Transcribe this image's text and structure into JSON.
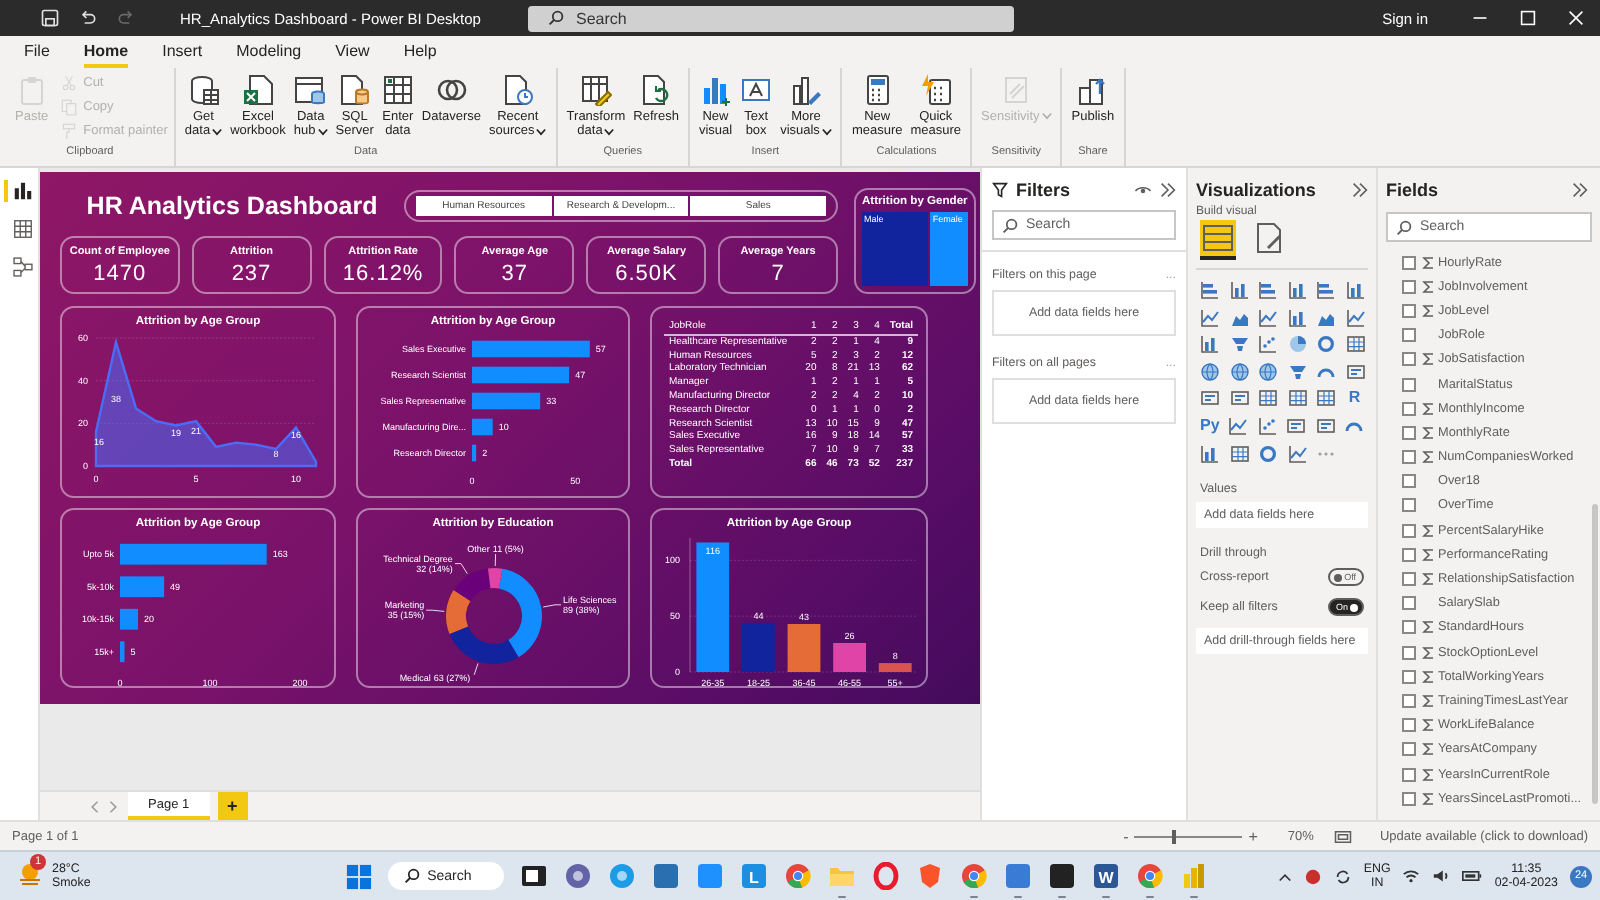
{
  "window": {
    "title": "HR_Analytics Dashboard - Power BI Desktop",
    "search": "Search",
    "sign_in": "Sign in"
  },
  "quick_access": [
    {
      "kind": "save",
      "disabled": false
    },
    {
      "kind": "undo",
      "disabled": false
    },
    {
      "kind": "redo",
      "disabled": true
    }
  ],
  "menu_tabs": [
    {
      "label": "File",
      "selected": false
    },
    {
      "label": "Home",
      "selected": true
    },
    {
      "label": "Insert",
      "selected": false
    },
    {
      "label": "Modeling",
      "selected": false
    },
    {
      "label": "View",
      "selected": false
    },
    {
      "label": "Help",
      "selected": false
    }
  ],
  "ribbon": [
    {
      "group": "Clipboard",
      "buttons": [
        {
          "kind": "paste",
          "label": "Paste",
          "disabled": true,
          "dropdown": false
        }
      ],
      "small_buttons": [
        {
          "kind": "cut",
          "label": "Cut",
          "disabled": true
        },
        {
          "kind": "copy",
          "label": "Copy",
          "disabled": true
        },
        {
          "kind": "painter",
          "label": "Format painter",
          "disabled": true
        }
      ]
    },
    {
      "group": "Data",
      "buttons": [
        {
          "kind": "database",
          "label": "Get\ndata",
          "disabled": false,
          "dropdown": true
        },
        {
          "kind": "excel",
          "label": "Excel\nworkbook",
          "disabled": false,
          "dropdown": false
        },
        {
          "kind": "datahub",
          "label": "Data\nhub",
          "disabled": false,
          "dropdown": true
        },
        {
          "kind": "sql",
          "label": "SQL\nServer",
          "disabled": false,
          "dropdown": false
        },
        {
          "kind": "enter",
          "label": "Enter\ndata",
          "disabled": false,
          "dropdown": false
        },
        {
          "kind": "dataverse",
          "label": "Dataverse",
          "disabled": false,
          "dropdown": false
        },
        {
          "kind": "recent",
          "label": "Recent\nsources",
          "disabled": false,
          "dropdown": true
        }
      ]
    },
    {
      "group": "Queries",
      "buttons": [
        {
          "kind": "transform",
          "label": "Transform\ndata",
          "disabled": false,
          "dropdown": true
        },
        {
          "kind": "refresh",
          "label": "Refresh",
          "disabled": false,
          "dropdown": false
        }
      ]
    },
    {
      "group": "Insert",
      "buttons": [
        {
          "kind": "newvisual",
          "label": "New\nvisual",
          "disabled": false,
          "dropdown": false
        },
        {
          "kind": "textbox",
          "label": "Text\nbox",
          "disabled": false,
          "dropdown": false
        },
        {
          "kind": "morevisuals",
          "label": "More\nvisuals",
          "disabled": false,
          "dropdown": true
        }
      ]
    },
    {
      "group": "Calculations",
      "buttons": [
        {
          "kind": "measure",
          "label": "New\nmeasure",
          "disabled": false,
          "dropdown": false
        },
        {
          "kind": "quickmeasure",
          "label": "Quick\nmeasure",
          "disabled": false,
          "dropdown": false
        }
      ]
    },
    {
      "group": "Sensitivity",
      "buttons": [
        {
          "kind": "sensitivity",
          "label": "Sensitivity",
          "disabled": true,
          "dropdown": true
        }
      ]
    },
    {
      "group": "Share",
      "buttons": [
        {
          "kind": "publish",
          "label": "Publish",
          "disabled": false,
          "dropdown": false
        }
      ]
    }
  ],
  "views": [
    {
      "kind": "report",
      "selected": true
    },
    {
      "kind": "table",
      "selected": false
    },
    {
      "kind": "model",
      "selected": false
    }
  ],
  "dashboard": {
    "title": "HR Analytics Dashboard",
    "slicer": [
      {
        "label": "Human Resources",
        "selected": false
      },
      {
        "label": "Research & Developm...",
        "selected": false
      },
      {
        "label": "Sales",
        "selected": false
      }
    ],
    "kpis": [
      {
        "label": "Count of Employee",
        "value": "1470"
      },
      {
        "label": "Attrition",
        "value": "237"
      },
      {
        "label": "Attrition Rate",
        "value": "16.12%"
      },
      {
        "label": "Average Age",
        "value": "37"
      },
      {
        "label": "Average Salary",
        "value": "6.50K"
      },
      {
        "label": "Average Years",
        "value": "7"
      }
    ],
    "gender": {
      "title": "Attrition by Gender",
      "segments": [
        {
          "label": "Male",
          "color": "#12239e"
        },
        {
          "label": "Female",
          "color": "#118dff"
        }
      ]
    },
    "area_chart": {
      "title": "Attrition by Age Group",
      "chart_data": {
        "type": "area",
        "x": [
          0,
          1,
          2,
          3,
          4,
          5,
          6,
          7,
          8,
          9,
          10,
          11
        ],
        "series": [
          {
            "color": "#4a6cf7",
            "values": [
              16,
              58,
              27,
              21,
              19,
              21,
              9,
              11,
              10,
              8,
              18,
              2
            ]
          }
        ],
        "xlim": [
          0,
          11
        ],
        "ylim": [
          0,
          60
        ],
        "xticks": [
          0,
          5,
          10
        ],
        "yticks": [
          0,
          20,
          40,
          60
        ],
        "annotations": [
          "16",
          "38",
          "19",
          "21",
          "8",
          "16"
        ]
      }
    },
    "role_chart": {
      "title": "Attrition by Age Group",
      "chart_data": {
        "type": "bar",
        "orientation": "horizontal",
        "categories": [
          "Sales Executive",
          "Research Scientist",
          "Sales Representative",
          "Manufacturing Dire...",
          "Research Director"
        ],
        "series": [
          {
            "color": "#118dff",
            "values": [
              57,
              47,
              33,
              10,
              2
            ]
          }
        ],
        "xlim": [
          0,
          60
        ],
        "xticks": [
          0,
          50
        ],
        "data_labels": true
      }
    },
    "matrix": {
      "columns": [
        "JobRole",
        "1",
        "2",
        "3",
        "4",
        "Total"
      ],
      "rows": [
        {
          "kind": "data",
          "cells": [
            "Healthcare Representative",
            "2",
            "2",
            "1",
            "4",
            "9"
          ]
        },
        {
          "kind": "data",
          "cells": [
            "Human Resources",
            "5",
            "2",
            "3",
            "2",
            "12"
          ]
        },
        {
          "kind": "data",
          "cells": [
            "Laboratory Technician",
            "20",
            "8",
            "21",
            "13",
            "62"
          ]
        },
        {
          "kind": "data",
          "cells": [
            "Manager",
            "1",
            "2",
            "1",
            "1",
            "5"
          ]
        },
        {
          "kind": "data",
          "cells": [
            "Manufacturing Director",
            "2",
            "2",
            "4",
            "2",
            "10"
          ]
        },
        {
          "kind": "data",
          "cells": [
            "Research Director",
            "0",
            "1",
            "1",
            "0",
            "2"
          ]
        },
        {
          "kind": "data",
          "cells": [
            "Research Scientist",
            "13",
            "10",
            "15",
            "9",
            "47"
          ]
        },
        {
          "kind": "data",
          "cells": [
            "Sales Executive",
            "16",
            "9",
            "18",
            "14",
            "57"
          ]
        },
        {
          "kind": "data",
          "cells": [
            "Sales Representative",
            "7",
            "10",
            "9",
            "7",
            "33"
          ]
        },
        {
          "kind": "total",
          "cells": [
            "Total",
            "66",
            "46",
            "73",
            "52",
            "237"
          ]
        }
      ]
    },
    "salary_chart": {
      "title": "Attrition by Age Group",
      "chart_data": {
        "type": "bar",
        "orientation": "horizontal",
        "categories": [
          "Upto 5k",
          "5k-10k",
          "10k-15k",
          "15k+"
        ],
        "series": [
          {
            "color": "#118dff",
            "values": [
              163,
              49,
              20,
              5
            ]
          }
        ],
        "xlim": [
          0,
          200
        ],
        "xticks": [
          0,
          100,
          200
        ],
        "data_labels": true
      }
    },
    "education_chart": {
      "title": "Attrition by Education",
      "chart_data": {
        "type": "donut",
        "categories": [
          "Life Sciences",
          "Medical",
          "Marketing",
          "Technical Degree",
          "Other"
        ],
        "values": [
          89,
          63,
          35,
          32,
          11
        ],
        "colors": [
          "#118dff",
          "#12239e",
          "#e66c37",
          "#6b007b",
          "#e044a7"
        ],
        "value_labels": [
          "89 (38%)",
          "63 (27%)",
          "35 (15%)",
          "32 (14%)",
          "11 (5%)"
        ]
      }
    },
    "age_chart": {
      "title": "Attrition by Age Group",
      "chart_data": {
        "type": "bar",
        "orientation": "vertical",
        "categories": [
          "26-35",
          "18-25",
          "36-45",
          "46-55",
          "55+"
        ],
        "series": [
          {
            "values": [
              116,
              44,
              43,
              26,
              8
            ]
          }
        ],
        "colors": [
          "#118dff",
          "#12239e",
          "#e66c37",
          "#e044a7",
          "#d9534f"
        ],
        "ylim": [
          0,
          120
        ],
        "yticks": [
          0,
          50,
          100
        ],
        "data_labels": true
      }
    }
  },
  "pages": [
    {
      "label": "Page 1",
      "selected": true
    }
  ],
  "add_page": "+",
  "filters": {
    "title": "Filters",
    "search": "Search",
    "sections": [
      {
        "heading": "Filters on this page",
        "more": "...",
        "drop": "Add data fields here"
      },
      {
        "heading": "Filters on all pages",
        "more": "...",
        "drop": "Add data fields here"
      }
    ]
  },
  "visualizations": {
    "title": "Visualizations",
    "subtitle": "Build visual",
    "modes": [
      {
        "kind": "build",
        "selected": true
      },
      {
        "kind": "format",
        "selected": false
      }
    ],
    "gallery": [
      [
        {
          "kind": "bar"
        },
        {
          "kind": "column"
        },
        {
          "kind": "bar"
        },
        {
          "kind": "column"
        },
        {
          "kind": "bar"
        },
        {
          "kind": "column"
        }
      ],
      [
        {
          "kind": "line"
        },
        {
          "kind": "area"
        },
        {
          "kind": "line"
        },
        {
          "kind": "column"
        },
        {
          "kind": "area"
        },
        {
          "kind": "line"
        }
      ],
      [
        {
          "kind": "column"
        },
        {
          "kind": "funnel"
        },
        {
          "kind": "scatter"
        },
        {
          "kind": "pie"
        },
        {
          "kind": "donut"
        },
        {
          "kind": "table"
        }
      ],
      [
        {
          "kind": "globe"
        },
        {
          "kind": "globe"
        },
        {
          "kind": "globe"
        },
        {
          "kind": "funnel"
        },
        {
          "kind": "gauge"
        },
        {
          "kind": "card"
        }
      ],
      [
        {
          "kind": "card"
        },
        {
          "kind": "card"
        },
        {
          "kind": "table"
        },
        {
          "kind": "table"
        },
        {
          "kind": "table"
        },
        {
          "kind": "text",
          "text": "R"
        }
      ],
      [
        {
          "kind": "text",
          "text": "Py"
        },
        {
          "kind": "line"
        },
        {
          "kind": "scatter"
        },
        {
          "kind": "card"
        },
        {
          "kind": "card"
        },
        {
          "kind": "gauge"
        }
      ],
      [
        {
          "kind": "column"
        },
        {
          "kind": "table"
        },
        {
          "kind": "donut"
        },
        {
          "kind": "line"
        },
        {
          "kind": "more"
        }
      ]
    ],
    "values_heading": "Values",
    "values_drop": "Add data fields here",
    "drill_heading": "Drill through",
    "toggles": [
      {
        "label": "Cross-report",
        "on": false,
        "state_text": "Off"
      },
      {
        "label": "Keep all filters",
        "on": true,
        "state_text": "On"
      }
    ],
    "drill_drop": "Add drill-through fields here"
  },
  "fields": {
    "title": "Fields",
    "search": "Search",
    "items": [
      {
        "name": "HourlyRate",
        "numeric": true,
        "checked": false
      },
      {
        "name": "JobInvolvement",
        "numeric": true,
        "checked": false
      },
      {
        "name": "JobLevel",
        "numeric": true,
        "checked": false
      },
      {
        "name": "JobRole",
        "numeric": false,
        "checked": false
      },
      {
        "name": "JobSatisfaction",
        "numeric": true,
        "checked": false
      },
      {
        "name": "MaritalStatus",
        "numeric": false,
        "checked": false
      },
      {
        "name": "MonthlyIncome",
        "numeric": true,
        "checked": false
      },
      {
        "name": "MonthlyRate",
        "numeric": true,
        "checked": false
      },
      {
        "name": "NumCompaniesWorked",
        "numeric": true,
        "checked": false
      },
      {
        "name": "Over18",
        "numeric": false,
        "checked": false
      },
      {
        "name": "OverTime",
        "numeric": false,
        "checked": false
      },
      {
        "name": "PercentSalaryHike",
        "numeric": true,
        "checked": false
      },
      {
        "name": "PerformanceRating",
        "numeric": true,
        "checked": false
      },
      {
        "name": "RelationshipSatisfaction",
        "numeric": true,
        "checked": false
      },
      {
        "name": "SalarySlab",
        "numeric": false,
        "checked": false
      },
      {
        "name": "StandardHours",
        "numeric": true,
        "checked": false
      },
      {
        "name": "StockOptionLevel",
        "numeric": true,
        "checked": false
      },
      {
        "name": "TotalWorkingYears",
        "numeric": true,
        "checked": false
      },
      {
        "name": "TrainingTimesLastYear",
        "numeric": true,
        "checked": false
      },
      {
        "name": "WorkLifeBalance",
        "numeric": true,
        "checked": false
      },
      {
        "name": "YearsAtCompany",
        "numeric": true,
        "checked": false
      },
      {
        "name": "YearsInCurrentRole",
        "numeric": true,
        "checked": false
      },
      {
        "name": "YearsSinceLastPromoti...",
        "numeric": true,
        "checked": false
      }
    ]
  },
  "status_bar": {
    "page": "Page 1 of 1",
    "zoom_out": "-",
    "zoom_in": "+",
    "zoom": {
      "level": 0.35
    },
    "zoom_text": "70%",
    "update": "Update available (click to download)"
  },
  "taskbar": {
    "weather": {
      "temp": "28°C",
      "condition": "Smoke",
      "badge": "1"
    },
    "search": "Search",
    "apps": [
      {
        "kind": "taskview",
        "color": "#222222",
        "running": false
      },
      {
        "kind": "round",
        "color": "#6264a7",
        "running": false
      },
      {
        "kind": "round",
        "color": "#1c9be6",
        "running": false
      },
      {
        "kind": "tile",
        "color": "#2a6fb0",
        "running": false
      },
      {
        "kind": "tile",
        "color": "#1e90ff",
        "running": false
      },
      {
        "kind": "tile",
        "color": "#1d8fe0",
        "text": "L",
        "running": false
      },
      {
        "kind": "chrome",
        "color": "#e8453c",
        "running": false
      },
      {
        "kind": "folder",
        "color": "#f4c542",
        "running": true
      },
      {
        "kind": "ring",
        "color": "#e81c2e",
        "running": false
      },
      {
        "kind": "shield",
        "color": "#fb542b",
        "running": false
      },
      {
        "kind": "chrome",
        "color": "#e8453c",
        "running": true
      },
      {
        "kind": "tile",
        "color": "#3a7bd5",
        "running": true
      },
      {
        "kind": "tile",
        "color": "#222222",
        "running": true
      },
      {
        "kind": "tile",
        "color": "#2b5797",
        "text": "W",
        "running": true
      },
      {
        "kind": "chrome",
        "color": "#e8453c",
        "running": true
      },
      {
        "kind": "bars",
        "color": "#f2c811",
        "running": true
      }
    ],
    "language": "ENG",
    "region": "IN",
    "time": "11:35",
    "date": "02-04-2023",
    "notifications": "24"
  }
}
